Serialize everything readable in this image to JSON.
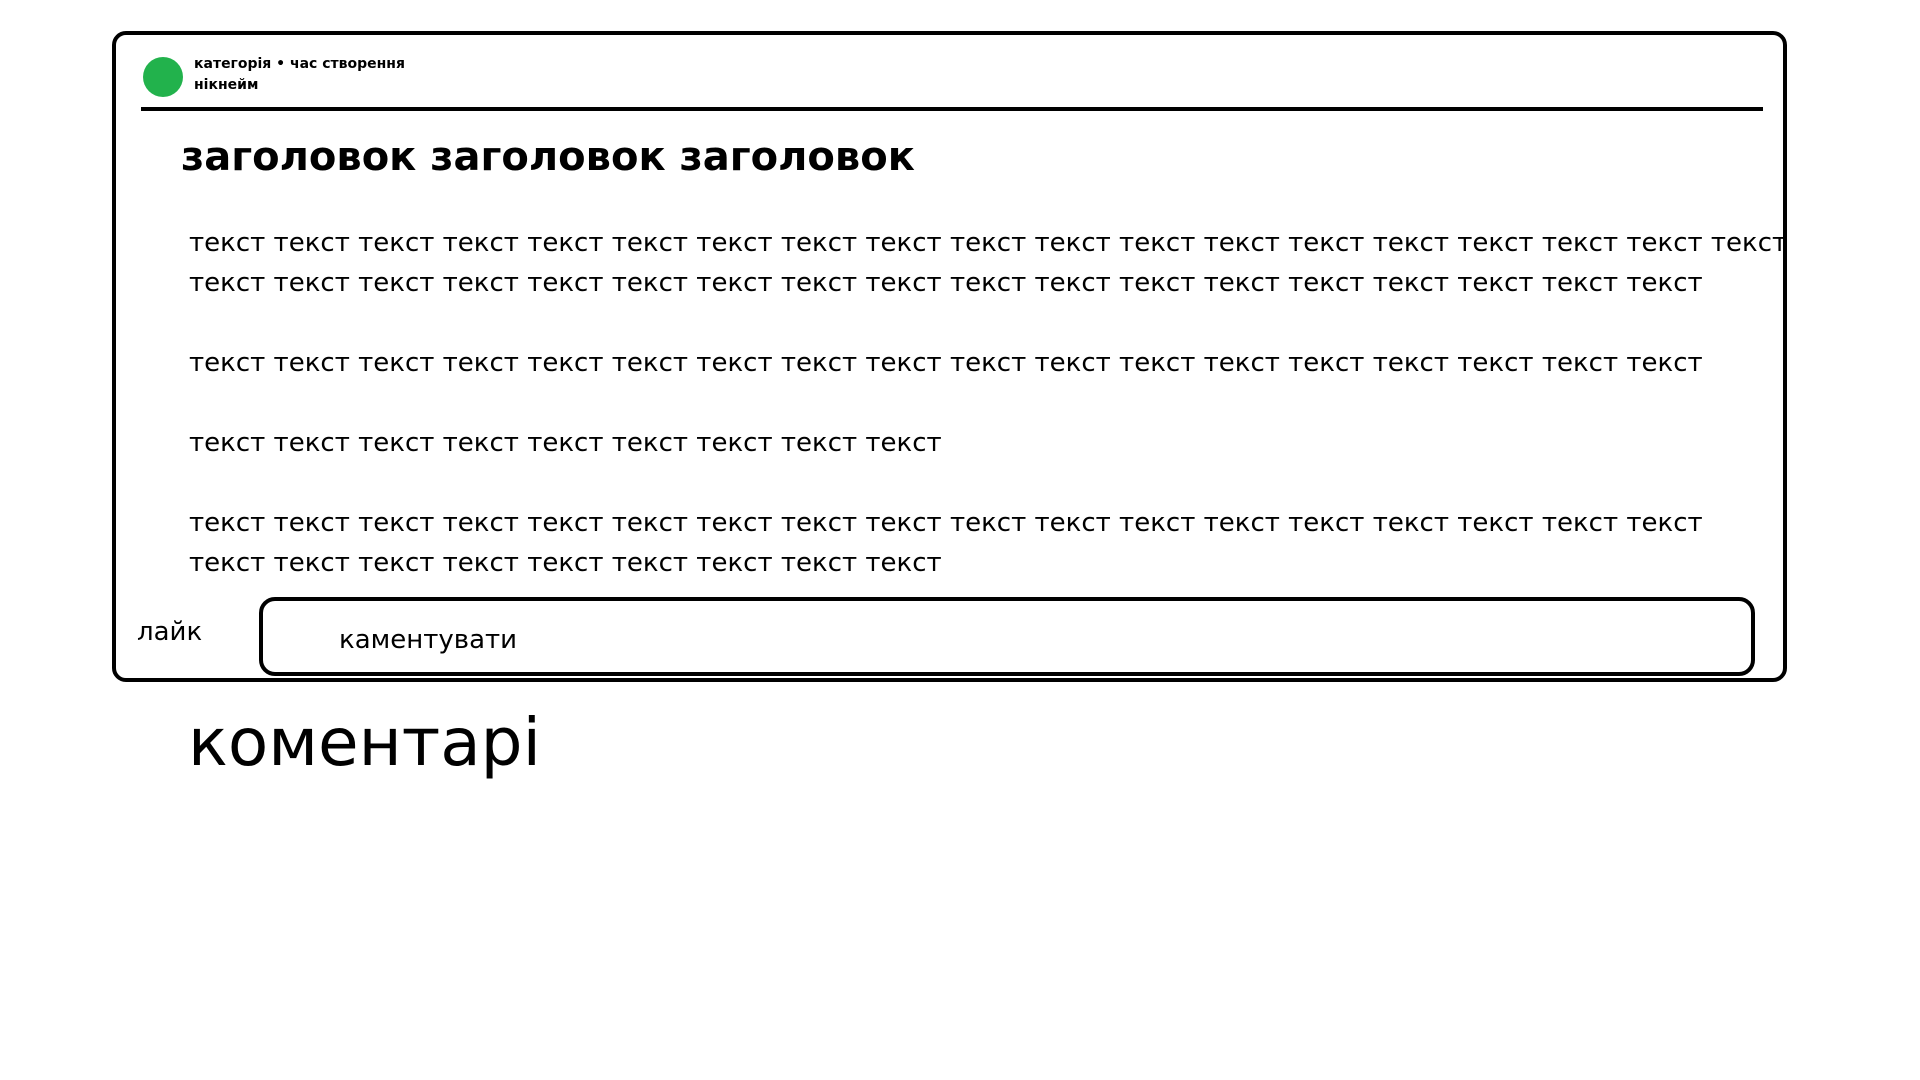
{
  "post": {
    "meta": {
      "category_time": "категорія • час створення",
      "nickname": "нікнейм",
      "avatar_color": "#22b24c"
    },
    "title": "заголовок  заголовок заголовок",
    "paragraphs": [
      {
        "lines": [
          "текст текст текст текст текст текст текст текст текст текст текст текст текст текст текст текст текст текст текст",
          "текст текст текст текст текст текст текст текст текст текст текст текст текст текст текст текст текст текст"
        ]
      },
      {
        "lines": [
          "текст текст текст текст текст текст текст текст текст текст текст текст текст текст текст текст текст текст"
        ]
      },
      {
        "lines": [
          "текст текст текст текст текст текст текст текст текст"
        ]
      },
      {
        "lines": [
          "текст текст текст текст текст текст текст текст текст текст текст текст текст текст текст текст текст текст",
          "текст текст текст текст текст текст текст текст текст"
        ]
      }
    ],
    "actions": {
      "like_label": "лайк",
      "comment_placeholder": "каментувати"
    }
  },
  "comments": {
    "heading": "коментарі"
  }
}
